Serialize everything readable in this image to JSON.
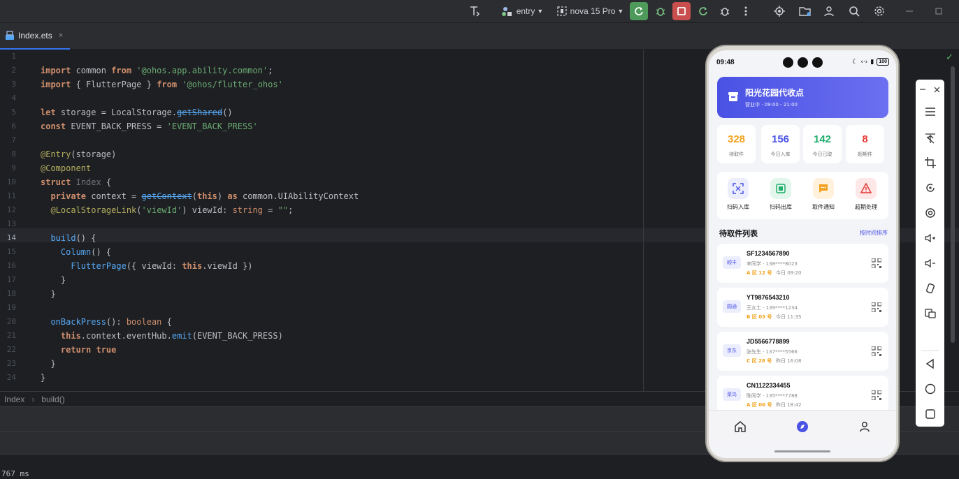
{
  "toolbar": {
    "module": "entry",
    "device": "nova 15 Pro"
  },
  "tab": {
    "filename": "Index.ets",
    "close": "×"
  },
  "editor": {
    "line_numbers": [
      "1",
      "2",
      "3",
      "4",
      "5",
      "6",
      "7",
      "8",
      "9",
      "10",
      "11",
      "12",
      "13",
      "14",
      "15",
      "16",
      "17",
      "18",
      "19",
      "20",
      "21",
      "22",
      "23",
      "24"
    ],
    "current_line": "14",
    "code": {
      "l2": {
        "import": "import",
        "name": " common ",
        "from": "from",
        "mod": " '@ohos.app.ability.common'",
        "end": ";"
      },
      "l3": {
        "import": "import",
        "name": " { FlutterPage } ",
        "from": "from",
        "mod": " '@ohos/flutter_ohos'"
      },
      "l5": {
        "let": "let",
        "a": " storage = LocalStorage.",
        "fn": "getShared",
        "b": "()"
      },
      "l6": {
        "const": "const",
        "a": " EVENT_BACK_PRESS = ",
        "str": "'EVENT_BACK_PRESS'"
      },
      "l8": {
        "dec": "@Entry",
        "a": "(storage)"
      },
      "l9": {
        "dec": "@Component"
      },
      "l10": {
        "struct": "struct",
        "a": " ",
        "name": "Index",
        "b": " {"
      },
      "l11": {
        "priv": "  private",
        "a": " context = ",
        "fn": "getContext",
        "b": "(",
        "this": "this",
        "c": ") ",
        "as": "as",
        "d": " common.",
        "type": "UIAbilityContext"
      },
      "l12": {
        "dec": "  @LocalStorageLink",
        "a": "(",
        "str": "'viewId'",
        "b": ") viewId: ",
        "type": "string",
        "c": " = ",
        "str2": "\"\"",
        "d": ";"
      },
      "l14": {
        "fn": "  build",
        "a": "() {"
      },
      "l15": {
        "cmp": "    Column",
        "a": "() {"
      },
      "l16": {
        "cmp": "      FlutterPage",
        "a": "({ viewId: ",
        "this": "this",
        "b": ".viewId })"
      },
      "l17": {
        "a": "    }"
      },
      "l18": {
        "a": "  }"
      },
      "l20": {
        "fn": "  onBackPress",
        "a": "(): ",
        "type": "boolean",
        "b": " {"
      },
      "l21": {
        "this": "    this",
        "a": ".context.eventHub.",
        "fn": "emit",
        "b": "(EVENT_BACK_PRESS)"
      },
      "l22": {
        "ret": "    return",
        "a": " ",
        "val": "true"
      },
      "l23": {
        "a": "  }"
      },
      "l24": {
        "a": "}"
      }
    }
  },
  "breadcrumb": {
    "item1": "Index",
    "sep": "›",
    "item2": "build()"
  },
  "status": {
    "timing": "767 ms"
  },
  "phone": {
    "time": "09:48",
    "battery": "100",
    "hero": {
      "title": "阳光花园代收点",
      "subtitle": "营业中 · 09:00 - 21:00"
    },
    "stats": [
      {
        "value": "328",
        "label": "待取件",
        "color": "#f2a11c"
      },
      {
        "value": "156",
        "label": "今日入库",
        "color": "#4a52e4"
      },
      {
        "value": "142",
        "label": "今日已取",
        "color": "#1fae6b"
      },
      {
        "value": "8",
        "label": "超期件",
        "color": "#e53935"
      }
    ],
    "actions": [
      {
        "label": "扫码入库",
        "bg": "#eceefe",
        "fg": "#4a52e4"
      },
      {
        "label": "扫码出库",
        "bg": "#e3f6ec",
        "fg": "#1fae6b"
      },
      {
        "label": "取件通知",
        "bg": "#fff1dc",
        "fg": "#f2a11c"
      },
      {
        "label": "超期处理",
        "bg": "#fde7e7",
        "fg": "#e53935"
      }
    ],
    "list": {
      "title": "待取件列表",
      "sort": "按时间排序",
      "items": [
        {
          "carrier": "顺丰",
          "tracking": "SF1234567890",
          "recipient": "李同学 · 138****8023",
          "location": "A 区 12 号",
          "time": "今日 09:20"
        },
        {
          "carrier": "圆通",
          "tracking": "YT9876543210",
          "recipient": "王女士 · 139****1234",
          "location": "B 区 03 号",
          "time": "今日 11:35"
        },
        {
          "carrier": "京东",
          "tracking": "JD5566778899",
          "recipient": "张先生 · 137****5566",
          "location": "C 区 28 号",
          "time": "昨日 16:08"
        },
        {
          "carrier": "菜鸟",
          "tracking": "CN1122334455",
          "recipient": "陈同学 · 135****7788",
          "location": "A 区 06 号",
          "time": "昨日 18:42"
        }
      ]
    }
  }
}
